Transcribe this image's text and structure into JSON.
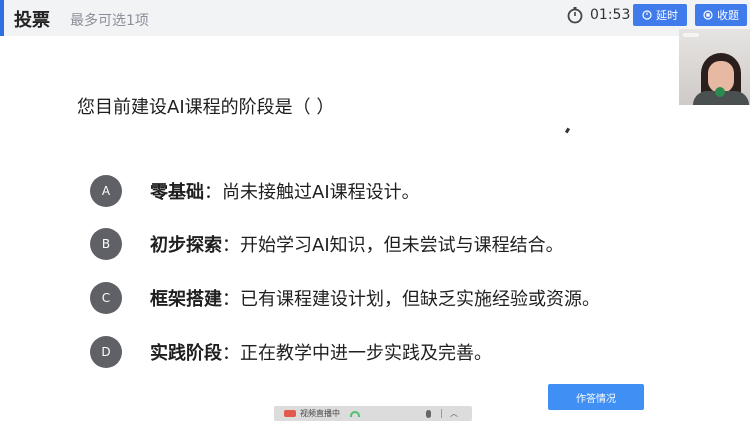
{
  "header": {
    "title": "投票",
    "subtitle": "最多可选1项",
    "timer": "01:53",
    "extend_label": "延时",
    "collect_label": "收题",
    "timer_icon": "stopwatch-icon",
    "accent_color": "#3f7bea"
  },
  "question": {
    "text": "您目前建设AI课程的阶段是（    ）"
  },
  "options": [
    {
      "letter": "A",
      "key": "零基础",
      "desc": "：尚未接触过AI课程设计。"
    },
    {
      "letter": "B",
      "key": "初步探索",
      "desc": "：开始学习AI知识，但未尝试与课程结合。"
    },
    {
      "letter": "C",
      "key": "框架搭建",
      "desc": "：已有课程建设计划，但缺乏实施经验或资源。"
    },
    {
      "letter": "D",
      "key": "实践阶段",
      "desc": "：正在教学中进一步实践及完善。"
    }
  ],
  "footer": {
    "answer_button": "作答情况",
    "live_label": "视频直播中"
  }
}
